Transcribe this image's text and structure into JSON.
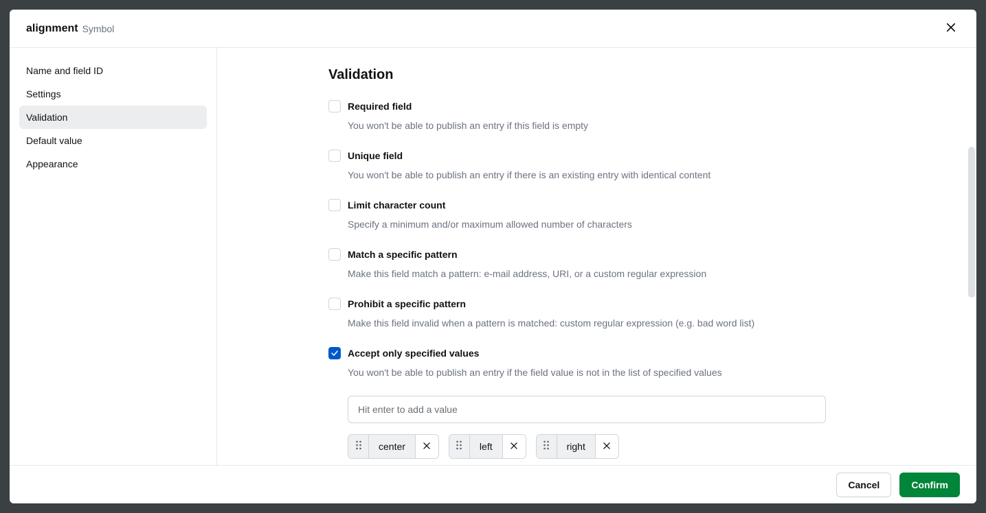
{
  "header": {
    "title": "alignment",
    "subtitle": "Symbol"
  },
  "sidebar": {
    "items": [
      {
        "label": "Name and field ID",
        "active": false
      },
      {
        "label": "Settings",
        "active": false
      },
      {
        "label": "Validation",
        "active": true
      },
      {
        "label": "Default value",
        "active": false
      },
      {
        "label": "Appearance",
        "active": false
      }
    ]
  },
  "main": {
    "heading": "Validation",
    "options": [
      {
        "key": "required",
        "label": "Required field",
        "desc": "You won't be able to publish an entry if this field is empty",
        "checked": false
      },
      {
        "key": "unique",
        "label": "Unique field",
        "desc": "You won't be able to publish an entry if there is an existing entry with identical content",
        "checked": false
      },
      {
        "key": "charcount",
        "label": "Limit character count",
        "desc": "Specify a minimum and/or maximum allowed number of characters",
        "checked": false
      },
      {
        "key": "match",
        "label": "Match a specific pattern",
        "desc": "Make this field match a pattern: e-mail address, URI, or a custom regular expression",
        "checked": false
      },
      {
        "key": "prohibit",
        "label": "Prohibit a specific pattern",
        "desc": "Make this field invalid when a pattern is matched: custom regular expression (e.g. bad word list)",
        "checked": false
      },
      {
        "key": "accept",
        "label": "Accept only specified values",
        "desc": "You won't be able to publish an entry if the field value is not in the list of specified values",
        "checked": true
      }
    ],
    "value_input_placeholder": "Hit enter to add a value",
    "chips": [
      "center",
      "left",
      "right"
    ]
  },
  "footer": {
    "cancel": "Cancel",
    "confirm": "Confirm"
  }
}
